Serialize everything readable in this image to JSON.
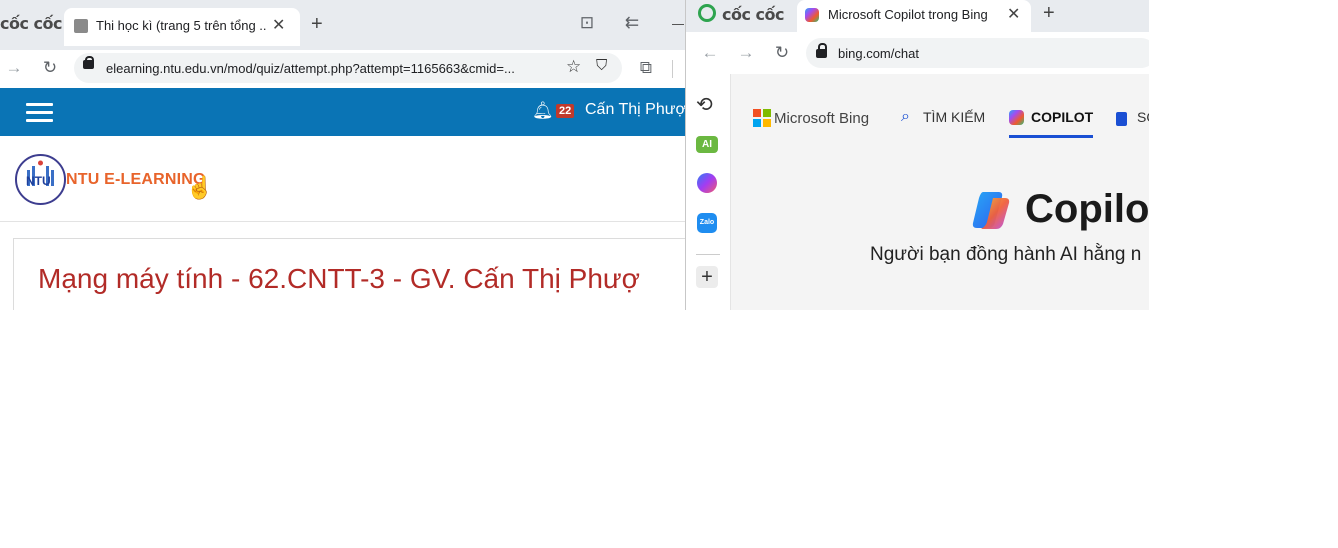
{
  "left_window": {
    "brand": "cốc cốc",
    "tab_title": "Thi học kì (trang 5 trên tổng ...",
    "url": "elearning.ntu.edu.vn/mod/quiz/attempt.php?attempt=1165663&cmid=...",
    "site": {
      "notification_count": "22",
      "user_name": "Cấn Thị Phượ",
      "logo_text": "NTU E-LEARNING",
      "logo_badge": "NTU",
      "course_title": "Mạng máy tính - 62.CNTT-3 - GV. Cấn Thị Phượ"
    }
  },
  "right_window": {
    "brand": "cốc cốc",
    "tab_title": "Microsoft Copilot trong Bing",
    "url": "bing.com/chat",
    "sidebar": {
      "ai_label": "AI",
      "zalo_label": "Zalo"
    },
    "bing": {
      "logo_text": "Microsoft Bing",
      "nav_search": "TÌM KIẾM",
      "nav_copilot": "COPILOT",
      "nav_partial": "SO",
      "title": "Copilot",
      "subtitle": "Người bạn đồng hành AI hằng n"
    }
  },
  "colors": {
    "site_header": "#0a74b5",
    "course_title": "#b22b27",
    "logo_orange": "#e8642b",
    "copilot_underline": "#1a4fd3"
  }
}
